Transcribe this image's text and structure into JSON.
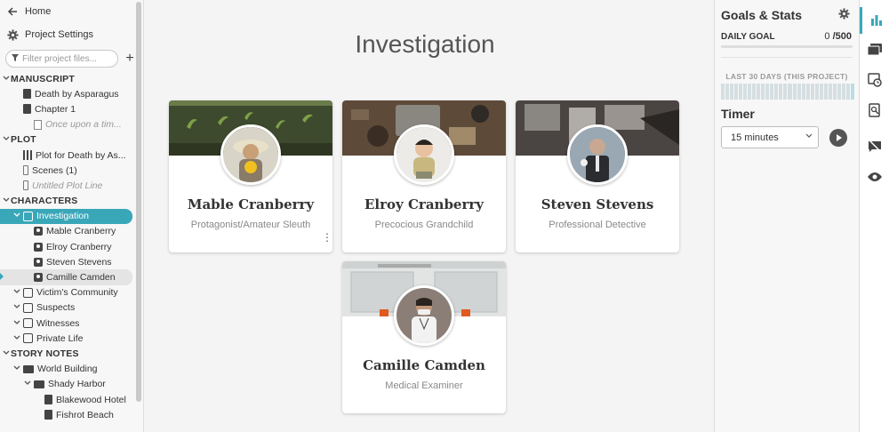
{
  "sidebar": {
    "home": "Home",
    "settings": "Project Settings",
    "filter_placeholder": "Filter project files...",
    "tree": [
      {
        "label": "MANUSCRIPT",
        "kind": "section",
        "depth": 0,
        "icon": "chevron-down-icon"
      },
      {
        "label": "Death by Asparagus",
        "kind": "doc",
        "depth": 1
      },
      {
        "label": "Chapter 1",
        "kind": "chapter",
        "depth": 1
      },
      {
        "label": "Once upon a tim...",
        "kind": "scene",
        "depth": 2
      },
      {
        "label": "PLOT",
        "kind": "section",
        "depth": 0
      },
      {
        "label": "Plot for Death by As...",
        "kind": "plot",
        "depth": 1
      },
      {
        "label": "Scenes  (1)",
        "kind": "plotline",
        "depth": 1
      },
      {
        "label": "Untitled Plot Line",
        "kind": "plotline-empty",
        "depth": 1
      },
      {
        "label": "CHARACTERS",
        "kind": "section",
        "depth": 0
      },
      {
        "label": "Investigation",
        "kind": "charfolder",
        "depth": 1,
        "state": "active"
      },
      {
        "label": "Mable Cranberry",
        "kind": "char",
        "depth": 2
      },
      {
        "label": "Elroy Cranberry",
        "kind": "char",
        "depth": 2
      },
      {
        "label": "Steven Stevens",
        "kind": "char",
        "depth": 2
      },
      {
        "label": "Camille Camden",
        "kind": "char",
        "depth": 2,
        "state": "selected"
      },
      {
        "label": "Victim's Community",
        "kind": "charfolder",
        "depth": 1
      },
      {
        "label": "Suspects",
        "kind": "charfolder",
        "depth": 1
      },
      {
        "label": "Witnesses",
        "kind": "charfolder",
        "depth": 1
      },
      {
        "label": "Private Life",
        "kind": "charfolder",
        "depth": 1
      },
      {
        "label": "STORY NOTES",
        "kind": "section",
        "depth": 0
      },
      {
        "label": "World Building",
        "kind": "folder",
        "depth": 1
      },
      {
        "label": "Shady Harbor",
        "kind": "folder",
        "depth": 2
      },
      {
        "label": "Blakewood Hotel",
        "kind": "doc",
        "depth": 3
      },
      {
        "label": "Fishrot Beach",
        "kind": "doc",
        "depth": 3
      }
    ]
  },
  "main": {
    "title": "Investigation",
    "cards": [
      {
        "name": "Mable Cranberry",
        "role": "Protagonist/Amateur Sleuth",
        "banner_color": "#4a5a38"
      },
      {
        "name": "Elroy Cranberry",
        "role": "Precocious Grandchild",
        "banner_color": "#6b5846"
      },
      {
        "name": "Steven Stevens",
        "role": "Professional Detective",
        "banner_color": "#5b5350"
      },
      {
        "name": "Camille Camden",
        "role": "Medical Examiner",
        "banner_color": "#d9dcdc"
      }
    ]
  },
  "panel": {
    "title": "Goals & Stats",
    "daily_goal_label": "DAILY GOAL",
    "daily_goal_current": "0",
    "daily_goal_target": "/500",
    "last30_label": "LAST 30 DAYS (THIS PROJECT)",
    "timer_label": "Timer",
    "timer_value": "15 minutes"
  },
  "colors": {
    "accent": "#3aa7b9"
  }
}
